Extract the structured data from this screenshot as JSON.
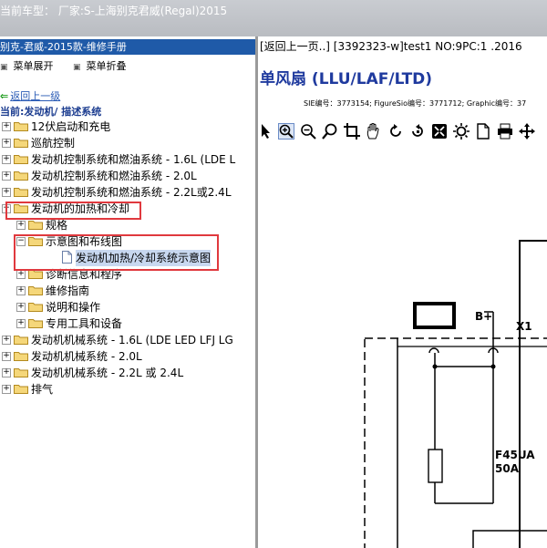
{
  "window": {
    "title": "当前车型： 厂家:S-上海别克君威(Regal)2015"
  },
  "left_panel": {
    "manual_title": "别克-君威-2015款-维修手册",
    "menu": [
      {
        "label": "菜单展开",
        "icon": "menu-expand-icon"
      },
      {
        "label": "菜单折叠",
        "icon": "menu-collapse-icon"
      }
    ],
    "back_link": "返回上一级",
    "current_path": "当前:发动机/ 描述系统",
    "tree": [
      {
        "label": "12伏启动和充电",
        "expander": "+"
      },
      {
        "label": "巡航控制",
        "expander": "+"
      },
      {
        "label": "发动机控制系统和燃油系统 - 1.6L (LDE L",
        "expander": "+"
      },
      {
        "label": "发动机控制系统和燃油系统 - 2.0L",
        "expander": "+"
      },
      {
        "label": "发动机控制系统和燃油系统 - 2.2L或2.4L",
        "expander": "+"
      },
      {
        "label": "发动机的加热和冷却",
        "expander": "−"
      },
      {
        "label": "规格",
        "expander": "+"
      },
      {
        "label": "示意图和布线图",
        "expander": "−"
      },
      {
        "label": "发动机加热/冷却系统示意图",
        "expander": ""
      },
      {
        "label": "诊断信息和程序",
        "expander": "+"
      },
      {
        "label": "维修指南",
        "expander": "+"
      },
      {
        "label": "说明和操作",
        "expander": "+"
      },
      {
        "label": "专用工具和设备",
        "expander": "+"
      },
      {
        "label": "发动机机械系统 - 1.6L (LDE LED LFJ LG",
        "expander": "+"
      },
      {
        "label": "发动机机械系统 - 2.0L",
        "expander": "+"
      },
      {
        "label": "发动机机械系统 - 2.2L 或 2.4L",
        "expander": "+"
      },
      {
        "label": "排气",
        "expander": "+"
      }
    ]
  },
  "right_panel": {
    "top_line": "[返回上一页..] [3392323-w]test1 NO:9PC:1 .2016",
    "title": "单风扇 (LLU/LAF/LTD)",
    "ids": "SIE编号：3773154;  FigureSio编号：3771712;  Graphic编号：37",
    "toolbar": [
      "pointer-icon",
      "zoom-in-icon",
      "zoom-out-icon",
      "search-icon",
      "crop-icon",
      "pan-hand-icon",
      "rotate-left-icon",
      "rotate-right-icon",
      "fit-page-icon",
      "brightness-icon",
      "page-icon",
      "print-icon",
      "move-icon"
    ],
    "diagram": {
      "labels": {
        "bplus": "B+",
        "x1": "X1",
        "fuse": "F45UA",
        "amp": "50A"
      }
    }
  },
  "colors": {
    "tree_selected": "#c8d8f0",
    "highlight_box": "#e0393e",
    "title_blue": "#1f3a9e",
    "header_blue": "#1f5aa8"
  }
}
